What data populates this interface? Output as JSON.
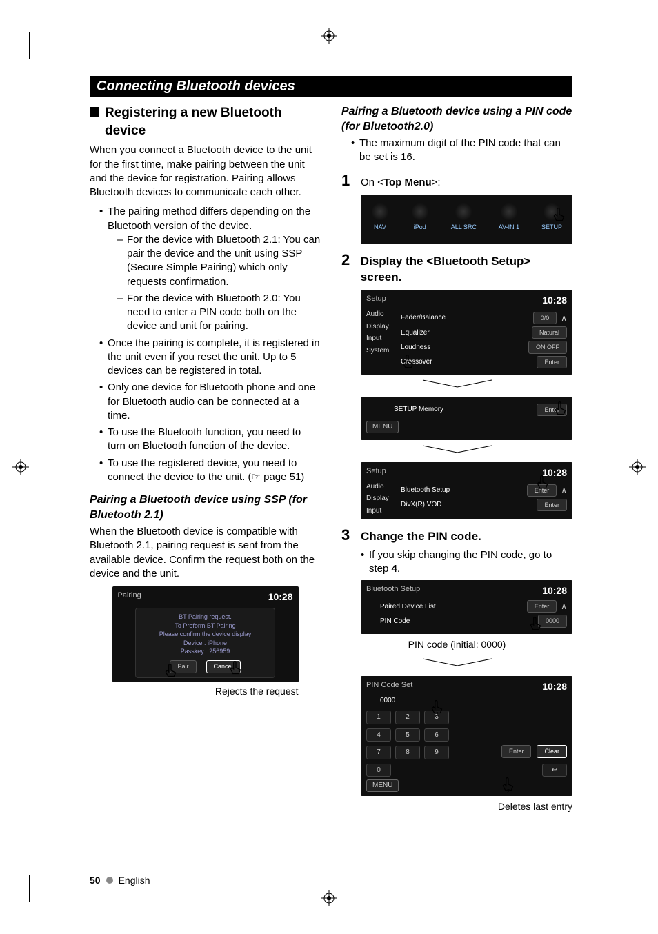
{
  "section_title": "Connecting Bluetooth devices",
  "left": {
    "heading": "Registering a new Bluetooth device",
    "intro": "When you connect a Bluetooth device to the unit for the first time, make pairing between the unit and the device for registration. Pairing allows Bluetooth devices to communicate each other.",
    "bullets": [
      "The pairing method differs depending on the Bluetooth version of the device.",
      "Once the pairing is complete, it is registered in the unit even if you reset the unit. Up to 5 devices can be registered in total.",
      "Only one device for Bluetooth phone and one for Bluetooth audio can be connected at a time.",
      "To use the Bluetooth function, you need to turn on Bluetooth function of the device.",
      "To use the registered device, you need to connect the device to the unit. (☞ page 51)"
    ],
    "sub_bullets": [
      "For the device with Bluetooth 2.1: You can pair the device and the unit using SSP (Secure Simple Pairing) which only requests confirmation.",
      "For the device with Bluetooth 2.0: You need to enter a PIN code both on the device and unit for pairing."
    ],
    "ssp_heading": "Pairing a Bluetooth device using SSP (for Bluetooth 2.1)",
    "ssp_body": "When the Bluetooth device is compatible with Bluetooth 2.1, pairing request is sent from the available device. Confirm the request both on the device and the unit.",
    "pairing_ss": {
      "title": "Pairing",
      "time": "10:28",
      "lines": "BT Pairing request.\nTo Preform BT Pairing\nPlease confirm the device display\nDevice : iPhone\nPasskey : 256959",
      "pair": "Pair",
      "cancel": "Cancel"
    },
    "reject_caption": "Rejects the request"
  },
  "right": {
    "pin_heading": "Pairing a Bluetooth device using a PIN code (for Bluetooth2.0)",
    "pin_bullet": "The maximum digit of the PIN code that can be set is 16.",
    "step1_pre": "On <",
    "step1_bold": "Top Menu",
    "step1_post": ">:",
    "topmenu": {
      "items": [
        "NAV",
        "iPod",
        "ALL SRC",
        "AV-IN 1",
        "SETUP"
      ]
    },
    "step2_text": "Display the <Bluetooth Setup> screen.",
    "setup_ss1": {
      "title": "Setup",
      "time": "10:28",
      "side": [
        "Audio",
        "Display",
        "Input",
        "System"
      ],
      "rows": [
        {
          "label": "Fader/Balance",
          "btn": "0/0"
        },
        {
          "label": "Equalizer",
          "btn": "Natural"
        },
        {
          "label": "Loudness",
          "btn": "ON   OFF"
        },
        {
          "label": "Crossover",
          "btn": "Enter"
        }
      ],
      "mem_label": "SETUP Memory",
      "mem_btn": "Enter",
      "menu": "MENU"
    },
    "setup_ss2": {
      "title": "Setup",
      "time": "10:28",
      "side": [
        "Audio",
        "Display",
        "Input"
      ],
      "rows": [
        {
          "label": "Bluetooth Setup",
          "btn": "Enter"
        },
        {
          "label": "DivX(R) VOD",
          "btn": "Enter"
        }
      ]
    },
    "step3_text": "Change the PIN code.",
    "step3_bullet_pre": "If you skip changing the PIN code, go to step ",
    "step3_bullet_bold": "4",
    "step3_bullet_post": ".",
    "bt_ss": {
      "title": "Bluetooth Setup",
      "time": "10:28",
      "rows": [
        {
          "label": "Paired Device List",
          "btn": "Enter"
        },
        {
          "label": "PIN Code",
          "btn": "0000"
        }
      ]
    },
    "pin_caption": "PIN code (initial: 0000)",
    "pinset_ss": {
      "title": "PIN Code Set",
      "time": "10:28",
      "value": "0000",
      "keys": [
        "1",
        "2",
        "3",
        "4",
        "5",
        "6",
        "7",
        "8",
        "9"
      ],
      "zero": "0",
      "enter": "Enter",
      "clear": "Clear",
      "menu": "MENU"
    },
    "delete_caption": "Deletes last entry"
  },
  "footer": {
    "page": "50",
    "lang": "English"
  }
}
